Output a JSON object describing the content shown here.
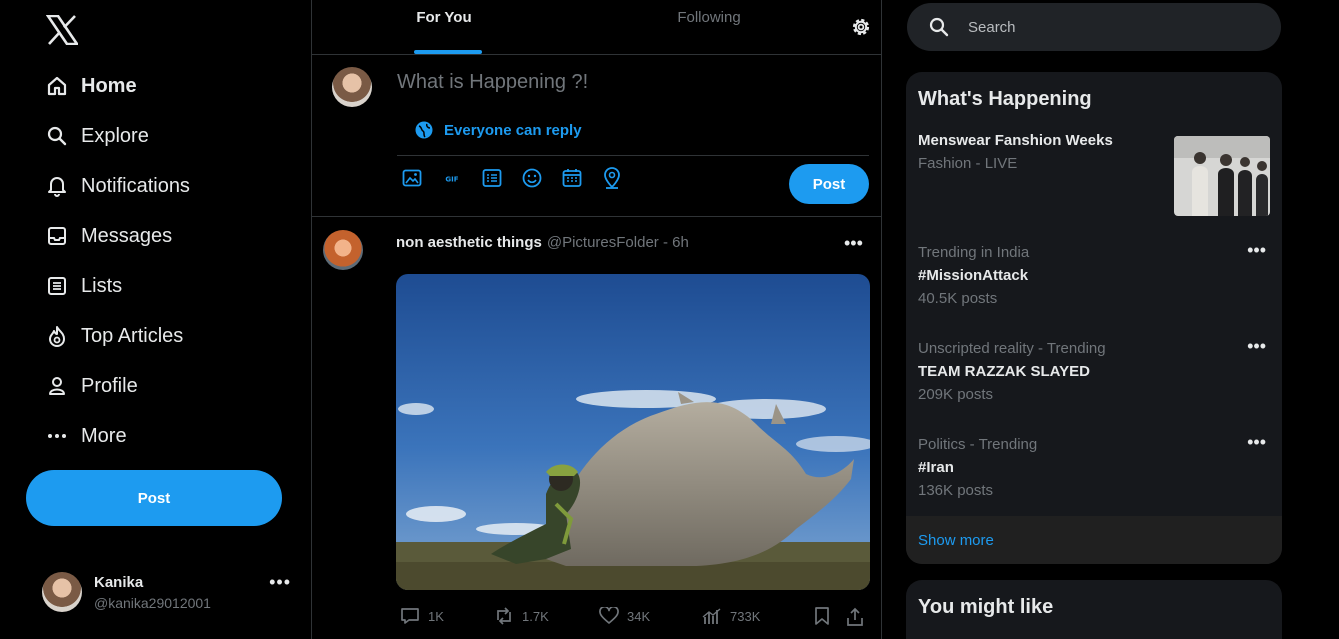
{
  "sidebar": {
    "logo": "x-logo-icon",
    "nav": [
      {
        "label": "Home",
        "icon": "home-icon",
        "active": true
      },
      {
        "label": "Explore",
        "icon": "search-icon"
      },
      {
        "label": "Notifications",
        "icon": "bell-icon"
      },
      {
        "label": "Messages",
        "icon": "mail-icon"
      },
      {
        "label": "Lists",
        "icon": "list-icon"
      },
      {
        "label": "Top Articles",
        "icon": "flame-icon"
      },
      {
        "label": "Profile",
        "icon": "person-icon"
      },
      {
        "label": "More",
        "icon": "more-icon"
      }
    ],
    "post_label": "Post",
    "account": {
      "name": "Kanika",
      "handle": "@kanika29012001"
    }
  },
  "tabs": {
    "for_you": "For You",
    "following": "Following"
  },
  "composer": {
    "placeholder": "What is Happening ?!",
    "reply_setting": "Everyone can reply",
    "post_label": "Post",
    "tools": [
      "image-icon",
      "gif-icon",
      "poll-icon",
      "emoji-icon",
      "schedule-icon",
      "location-icon"
    ]
  },
  "tweet": {
    "author": "non aesthetic things",
    "handle": "@PicturesFolder",
    "time": "6h",
    "meta": "@PicturesFolder - 6h",
    "media": "photo-rhino-and-keeper",
    "stats": {
      "replies": "1K",
      "reposts": "1.7K",
      "likes": "34K",
      "views": "733K"
    }
  },
  "right": {
    "search_placeholder": "Search",
    "happening_title": "What's Happening",
    "live": {
      "title": "Menswear Fanshion Weeks",
      "subtitle": "Fashion - LIVE"
    },
    "trends": [
      {
        "context": "Trending in India",
        "title": "#MissionAttack",
        "count": "40.5K posts"
      },
      {
        "context": "Unscripted reality - Trending",
        "title": "TEAM RAZZAK SLAYED",
        "count": "209K posts"
      },
      {
        "context": "Politics - Trending",
        "title": "#Iran",
        "count": "136K posts"
      }
    ],
    "show_more": "Show more",
    "might_like_title": "You might like"
  },
  "colors": {
    "accent": "#1d9bf0",
    "background": "#000000",
    "muted": "#71767b",
    "panel": "#16181c"
  }
}
